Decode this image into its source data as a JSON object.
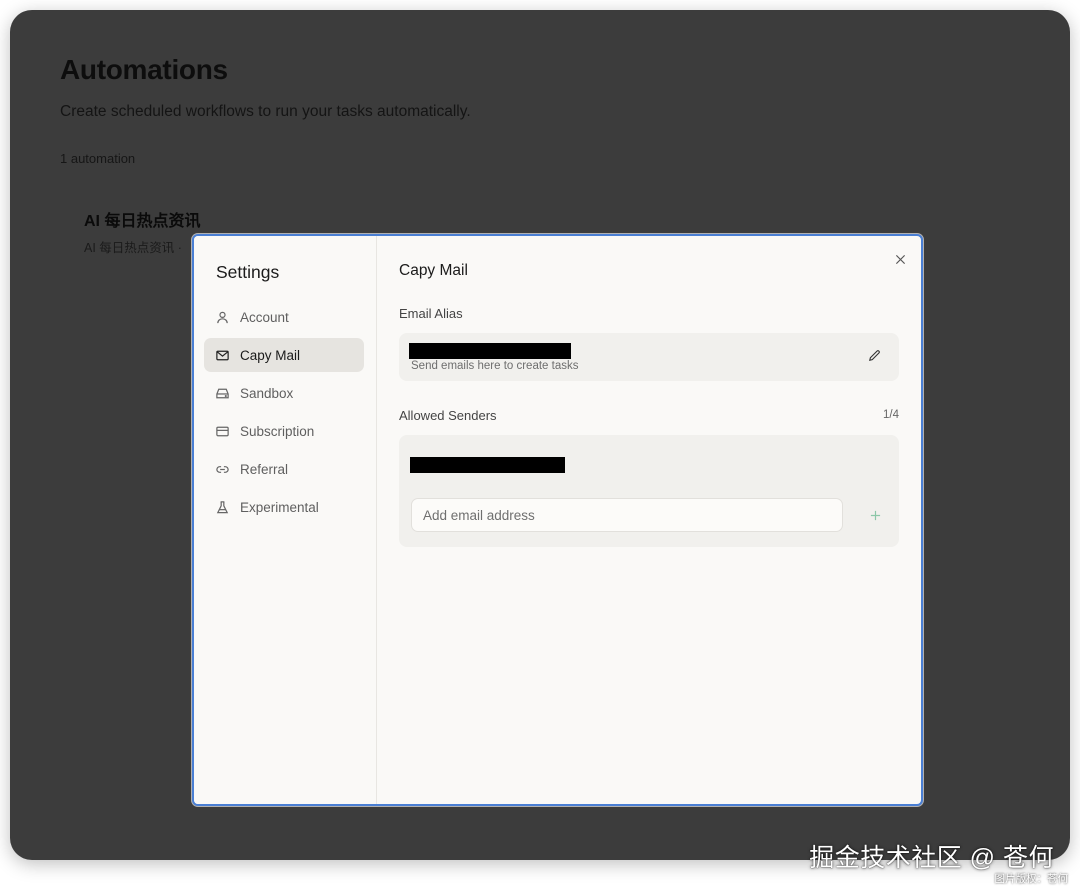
{
  "background": {
    "title": "Automations",
    "subtitle": "Create scheduled workflows to run your tasks automatically.",
    "count": "1 automation",
    "card": {
      "title": "AI 每日热点资讯",
      "subtitle": "AI 每日热点资讯 ·"
    }
  },
  "settings": {
    "title": "Settings",
    "nav": [
      {
        "label": "Account",
        "icon": "user-icon",
        "active": false
      },
      {
        "label": "Capy Mail",
        "icon": "mail-icon",
        "active": true
      },
      {
        "label": "Sandbox",
        "icon": "drive-icon",
        "active": false
      },
      {
        "label": "Subscription",
        "icon": "credit-card-icon",
        "active": false
      },
      {
        "label": "Referral",
        "icon": "link-icon",
        "active": false
      },
      {
        "label": "Experimental",
        "icon": "flask-icon",
        "active": false
      }
    ]
  },
  "capy_mail": {
    "title": "Capy Mail",
    "email_alias_label": "Email Alias",
    "alias_hint": "Send emails here to create tasks",
    "allowed_senders_label": "Allowed Senders",
    "sender_count": "1/4",
    "add_placeholder": "Add email address"
  },
  "watermark": {
    "main": "掘金技术社区 @ 苍何",
    "sub": "图片版权：苍何"
  },
  "colors": {
    "accent_border": "#4a7fd4",
    "overlay": "#3c3c3c",
    "active_nav": "#e6e4e0",
    "add_icon": "#8cc7a8"
  }
}
